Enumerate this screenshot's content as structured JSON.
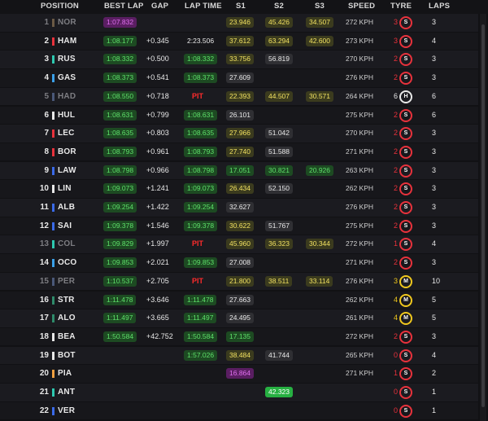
{
  "header": {
    "position": "POSITION",
    "best_lap": "BEST LAP",
    "gap": "GAP",
    "lap_time": "LAP TIME",
    "s1": "S1",
    "s2": "S2",
    "s3": "S3",
    "speed": "SPEED",
    "tyre": "TYRE",
    "laps": "LAPS"
  },
  "colors": {
    "purple": "#e070f0",
    "green": "#5ee06a",
    "yellow": "#f0e060",
    "pit": "#ff2b2b",
    "soft": "#e8323c",
    "medium": "#f0c81e",
    "hard": "#e8e8e8"
  },
  "rows": [
    {
      "pos": "1",
      "team_color": "#6b5a45",
      "driver": "NOR",
      "dim": true,
      "best": "1:07.832",
      "best_c": "purple",
      "gap": "",
      "lap": "",
      "lap_c": "",
      "pit": false,
      "s1": "23.946",
      "s1_c": "yellow",
      "s2": "45.426",
      "s2_c": "yellow",
      "s3": "34.507",
      "s3_c": "yellow",
      "speed": "272 KPH",
      "tlaps": "3",
      "tyre": "S",
      "tyre_c": "soft",
      "laps": "3"
    },
    {
      "pos": "2",
      "team_color": "#e8323c",
      "driver": "HAM",
      "dim": false,
      "best": "1:08.177",
      "best_c": "green",
      "gap": "+0.345",
      "lap": "2:23.506",
      "lap_c": "none",
      "pit": false,
      "s1": "37.612",
      "s1_c": "yellow",
      "s2": "63.294",
      "s2_c": "yellow",
      "s3": "42.600",
      "s3_c": "yellow",
      "speed": "273 KPH",
      "tlaps": "3",
      "tyre": "S",
      "tyre_c": "soft",
      "laps": "4"
    },
    {
      "pos": "3",
      "team_color": "#2ec9b0",
      "driver": "RUS",
      "dim": false,
      "best": "1:08.332",
      "best_c": "green",
      "gap": "+0.500",
      "lap": "1:08.332",
      "lap_c": "green",
      "pit": false,
      "s1": "33.756",
      "s1_c": "yellow",
      "s2": "56.819",
      "s2_c": "white",
      "s3": "",
      "s3_c": "",
      "speed": "270 KPH",
      "tlaps": "2",
      "tyre": "S",
      "tyre_c": "soft",
      "laps": "3"
    },
    {
      "pos": "4",
      "team_color": "#3aa0e8",
      "driver": "GAS",
      "dim": false,
      "best": "1:08.373",
      "best_c": "green",
      "gap": "+0.541",
      "lap": "1:08.373",
      "lap_c": "green",
      "pit": false,
      "s1": "27.609",
      "s1_c": "white",
      "s2": "",
      "s2_c": "",
      "s3": "",
      "s3_c": "",
      "speed": "276 KPH",
      "tlaps": "2",
      "tyre": "S",
      "tyre_c": "soft",
      "laps": "3"
    },
    {
      "pos": "5",
      "team_color": "#4a5878",
      "driver": "HAD",
      "dim": true,
      "best": "1:08.550",
      "best_c": "green",
      "gap": "+0.718",
      "lap": "",
      "lap_c": "",
      "pit": true,
      "pit_label": "PIT",
      "s1": "22.393",
      "s1_c": "yellow",
      "s2": "44.507",
      "s2_c": "yellow",
      "s3": "30.571",
      "s3_c": "yellow",
      "speed": "264 KPH",
      "tlaps": "6",
      "tyre": "H",
      "tyre_c": "hard",
      "laps": "6"
    },
    {
      "pos": "6",
      "team_color": "#e8e8e8",
      "driver": "HUL",
      "dim": false,
      "best": "1:08.631",
      "best_c": "green",
      "gap": "+0.799",
      "lap": "1:08.631",
      "lap_c": "green",
      "pit": false,
      "s1": "26.101",
      "s1_c": "white",
      "s2": "",
      "s2_c": "",
      "s3": "",
      "s3_c": "",
      "speed": "275 KPH",
      "tlaps": "2",
      "tyre": "S",
      "tyre_c": "soft",
      "laps": "6"
    },
    {
      "pos": "7",
      "team_color": "#e8323c",
      "driver": "LEC",
      "dim": false,
      "best": "1:08.635",
      "best_c": "green",
      "gap": "+0.803",
      "lap": "1:08.635",
      "lap_c": "green",
      "pit": false,
      "s1": "27.966",
      "s1_c": "yellow",
      "s2": "51.042",
      "s2_c": "white",
      "s3": "",
      "s3_c": "",
      "speed": "270 KPH",
      "tlaps": "2",
      "tyre": "S",
      "tyre_c": "soft",
      "laps": "3"
    },
    {
      "pos": "8",
      "team_color": "#e8323c",
      "driver": "BOR",
      "dim": false,
      "best": "1:08.793",
      "best_c": "green",
      "gap": "+0.961",
      "lap": "1:08.793",
      "lap_c": "green",
      "pit": false,
      "s1": "27.740",
      "s1_c": "yellow",
      "s2": "51.588",
      "s2_c": "white",
      "s3": "",
      "s3_c": "",
      "speed": "271 KPH",
      "tlaps": "2",
      "tyre": "S",
      "tyre_c": "soft",
      "laps": "3"
    },
    {
      "pos": "9",
      "team_color": "#3a6ae8",
      "driver": "LAW",
      "dim": false,
      "best": "1:08.798",
      "best_c": "green",
      "gap": "+0.966",
      "lap": "1:08.798",
      "lap_c": "green",
      "pit": false,
      "s1": "17.051",
      "s1_c": "green",
      "s2": "30.821",
      "s2_c": "green",
      "s3": "20.926",
      "s3_c": "green",
      "speed": "263 KPH",
      "tlaps": "2",
      "tyre": "S",
      "tyre_c": "soft",
      "laps": "3"
    },
    {
      "pos": "10",
      "team_color": "#e8e8e8",
      "driver": "LIN",
      "dim": false,
      "best": "1:09.073",
      "best_c": "green",
      "gap": "+1.241",
      "lap": "1:09.073",
      "lap_c": "green",
      "pit": false,
      "s1": "26.434",
      "s1_c": "yellow",
      "s2": "52.150",
      "s2_c": "white",
      "s3": "",
      "s3_c": "",
      "speed": "262 KPH",
      "tlaps": "2",
      "tyre": "S",
      "tyre_c": "soft",
      "laps": "3"
    },
    {
      "pos": "11",
      "team_color": "#3a6ae8",
      "driver": "ALB",
      "dim": false,
      "best": "1:09.254",
      "best_c": "green",
      "gap": "+1.422",
      "lap": "1:09.254",
      "lap_c": "green",
      "pit": false,
      "s1": "32.627",
      "s1_c": "white",
      "s2": "",
      "s2_c": "",
      "s3": "",
      "s3_c": "",
      "speed": "276 KPH",
      "tlaps": "2",
      "tyre": "S",
      "tyre_c": "soft",
      "laps": "3"
    },
    {
      "pos": "12",
      "team_color": "#3a6ae8",
      "driver": "SAI",
      "dim": false,
      "best": "1:09.378",
      "best_c": "green",
      "gap": "+1.546",
      "lap": "1:09.378",
      "lap_c": "green",
      "pit": false,
      "s1": "30.622",
      "s1_c": "yellow",
      "s2": "51.767",
      "s2_c": "white",
      "s3": "",
      "s3_c": "",
      "speed": "275 KPH",
      "tlaps": "2",
      "tyre": "S",
      "tyre_c": "soft",
      "laps": "3"
    },
    {
      "pos": "13",
      "team_color": "#2ec9b0",
      "driver": "COL",
      "dim": true,
      "best": "1:09.829",
      "best_c": "green",
      "gap": "+1.997",
      "lap": "",
      "lap_c": "",
      "pit": true,
      "pit_label": "PIT",
      "s1": "45.960",
      "s1_c": "yellow",
      "s2": "36.323",
      "s2_c": "yellow",
      "s3": "30.344",
      "s3_c": "yellow",
      "speed": "272 KPH",
      "tlaps": "1",
      "tyre": "S",
      "tyre_c": "soft",
      "laps": "4"
    },
    {
      "pos": "14",
      "team_color": "#3aa0e8",
      "driver": "OCO",
      "dim": false,
      "best": "1:09.853",
      "best_c": "green",
      "gap": "+2.021",
      "lap": "1:09.853",
      "lap_c": "green",
      "pit": false,
      "s1": "27.008",
      "s1_c": "white",
      "s2": "",
      "s2_c": "",
      "s3": "",
      "s3_c": "",
      "speed": "271 KPH",
      "tlaps": "2",
      "tyre": "S",
      "tyre_c": "soft",
      "laps": "3"
    },
    {
      "pos": "15",
      "team_color": "#4a5878",
      "driver": "PER",
      "dim": true,
      "best": "1:10.537",
      "best_c": "green",
      "gap": "+2.705",
      "lap": "",
      "lap_c": "",
      "pit": true,
      "pit_label": "PIT",
      "s1": "21.800",
      "s1_c": "yellow",
      "s2": "38.511",
      "s2_c": "yellow",
      "s3": "33.114",
      "s3_c": "yellow",
      "speed": "276 KPH",
      "tlaps": "3",
      "tyre": "M",
      "tyre_c": "medium",
      "laps": "10"
    },
    {
      "pos": "16",
      "team_color": "#2e8a6a",
      "driver": "STR",
      "dim": false,
      "best": "1:11.478",
      "best_c": "green",
      "gap": "+3.646",
      "lap": "1:11.478",
      "lap_c": "green",
      "pit": false,
      "s1": "27.663",
      "s1_c": "white",
      "s2": "",
      "s2_c": "",
      "s3": "",
      "s3_c": "",
      "speed": "262 KPH",
      "tlaps": "4",
      "tyre": "M",
      "tyre_c": "medium",
      "laps": "5"
    },
    {
      "pos": "17",
      "team_color": "#2e8a6a",
      "driver": "ALO",
      "dim": false,
      "best": "1:11.497",
      "best_c": "green",
      "gap": "+3.665",
      "lap": "1:11.497",
      "lap_c": "green",
      "pit": false,
      "s1": "24.495",
      "s1_c": "white",
      "s2": "",
      "s2_c": "",
      "s3": "",
      "s3_c": "",
      "speed": "261 KPH",
      "tlaps": "4",
      "tyre": "M",
      "tyre_c": "medium",
      "laps": "5"
    },
    {
      "pos": "18",
      "team_color": "#e8e8e8",
      "driver": "BEA",
      "dim": false,
      "best": "1:50.584",
      "best_c": "green",
      "gap": "+42.752",
      "lap": "1:50.584",
      "lap_c": "green",
      "pit": false,
      "s1": "17.135",
      "s1_c": "green",
      "s2": "",
      "s2_c": "",
      "s3": "",
      "s3_c": "",
      "speed": "272 KPH",
      "tlaps": "2",
      "tyre": "S",
      "tyre_c": "soft",
      "laps": "3"
    },
    {
      "pos": "19",
      "team_color": "#e8e8e8",
      "driver": "BOT",
      "dim": false,
      "best": "",
      "best_c": "",
      "gap": "",
      "lap": "1:57.026",
      "lap_c": "green",
      "pit": false,
      "s1": "38.484",
      "s1_c": "yellow",
      "s2": "41.744",
      "s2_c": "white",
      "s3": "",
      "s3_c": "",
      "speed": "265 KPH",
      "tlaps": "0",
      "tyre": "S",
      "tyre_c": "soft",
      "laps": "4"
    },
    {
      "pos": "20",
      "team_color": "#f0a040",
      "driver": "PIA",
      "dim": false,
      "best": "",
      "best_c": "",
      "gap": "",
      "lap": "",
      "lap_c": "",
      "pit": false,
      "s1": "16.864",
      "s1_c": "purple",
      "s2": "",
      "s2_c": "",
      "s3": "",
      "s3_c": "",
      "speed": "271 KPH",
      "tlaps": "1",
      "tyre": "S",
      "tyre_c": "soft",
      "laps": "2"
    },
    {
      "pos": "21",
      "team_color": "#2ec9b0",
      "driver": "ANT",
      "dim": false,
      "best": "",
      "best_c": "",
      "gap": "",
      "lap": "",
      "lap_c": "",
      "pit": false,
      "s1": "",
      "s1_c": "",
      "s2": "42.323",
      "s2_c": "bright",
      "s3": "",
      "s3_c": "",
      "speed": "",
      "tlaps": "0",
      "tyre": "S",
      "tyre_c": "soft",
      "laps": "1"
    },
    {
      "pos": "22",
      "team_color": "#3a6ae8",
      "driver": "VER",
      "dim": false,
      "best": "",
      "best_c": "",
      "gap": "",
      "lap": "",
      "lap_c": "",
      "pit": false,
      "s1": "",
      "s1_c": "",
      "s2": "",
      "s2_c": "",
      "s3": "",
      "s3_c": "",
      "speed": "",
      "tlaps": "0",
      "tyre": "S",
      "tyre_c": "soft",
      "laps": "1"
    }
  ]
}
